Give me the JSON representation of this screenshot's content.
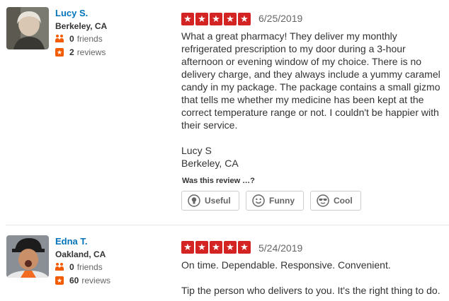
{
  "reviews": [
    {
      "user": {
        "name": "Lucy S.",
        "location": "Berkeley, CA",
        "friends": "0",
        "friends_label": "friends",
        "reviews": "2",
        "reviews_label": "reviews"
      },
      "rating": 5,
      "date": "6/25/2019",
      "text": "What a great pharmacy!  They deliver my monthly refrigerated prescription to my door during a 3-hour afternoon or evening window of my choice.  There is no delivery charge, and they always include a yummy caramel candy in my package.  The package contains a small gizmo that tells me whether my medicine has been kept at the correct temperature range or not.  I couldn't be happier with their service.\n\nLucy S\nBerkeley, CA",
      "helpful_prompt": "Was this review …?",
      "buttons": {
        "useful": "Useful",
        "funny": "Funny",
        "cool": "Cool"
      }
    },
    {
      "user": {
        "name": "Edna T.",
        "location": "Oakland, CA",
        "friends": "0",
        "friends_label": "friends",
        "reviews": "60",
        "reviews_label": "reviews"
      },
      "rating": 5,
      "date": "5/24/2019",
      "text": "On time. Dependable. Responsive. Convenient.\n\nTip the person who delivers to you. It's the right thing to do."
    }
  ],
  "colors": {
    "star_bg": "#d32323",
    "link": "#0073bb",
    "badge": "#f15c00"
  }
}
